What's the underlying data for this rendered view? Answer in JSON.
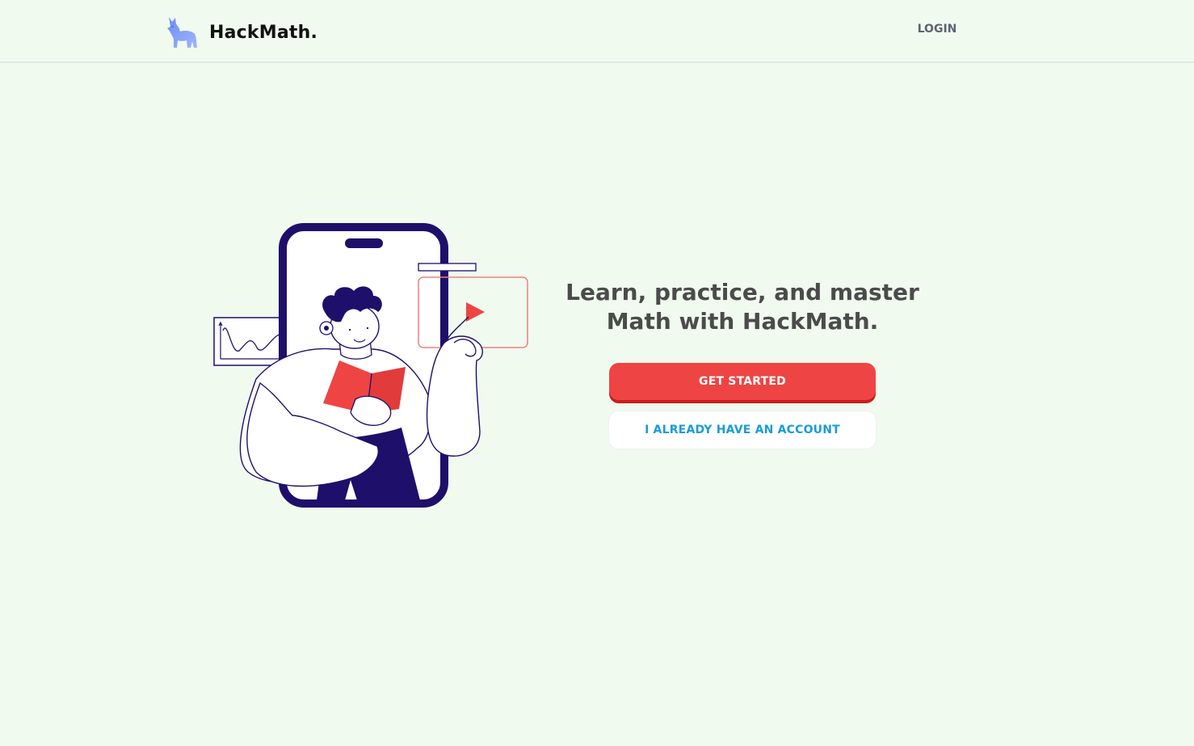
{
  "header": {
    "brand_name": "HackMath.",
    "logo_icon": "wolf-logo-icon",
    "login_label": "LOGIN"
  },
  "hero": {
    "title": "Learn, practice, and master Math with HackMath.",
    "illustration_icon": "student-phone-illustration",
    "get_started_label": "GET STARTED",
    "have_account_label": "I ALREADY HAVE AN ACCOUNT"
  },
  "colors": {
    "background": "#f0faef",
    "primary_button": "#ef4444",
    "secondary_text": "#1b9bd7",
    "title_text": "#4b4b4b",
    "illustration_navy": "#1e0f6b",
    "illustration_accent": "#ef4444"
  }
}
